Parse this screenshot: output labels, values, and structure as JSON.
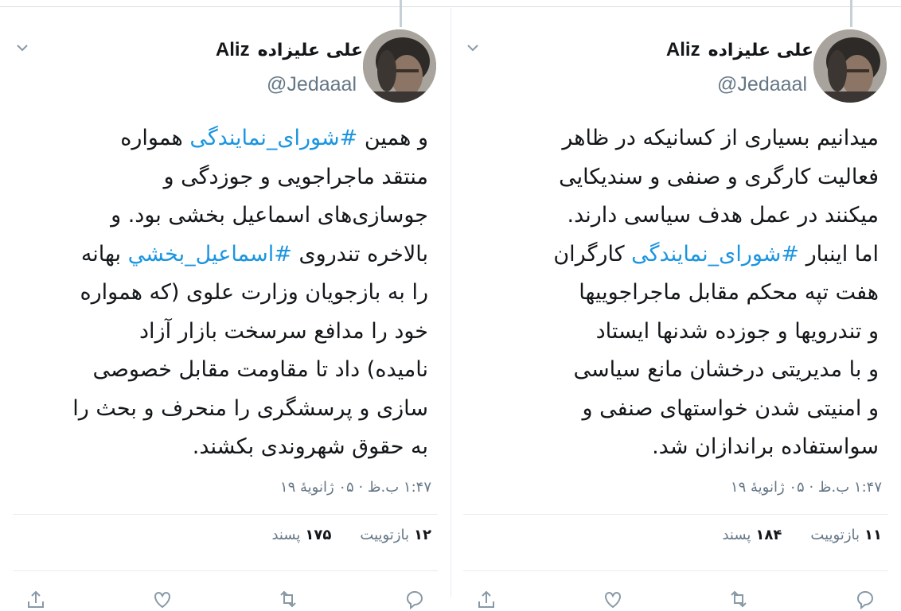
{
  "tweets": [
    {
      "display_name_fa": "علی علیزاده",
      "display_name_latin": "Aliz",
      "handle": "@Jedaaal",
      "body_lines": [
        {
          "pre": "و همین ",
          "tag": "#شورای_نمایندگی",
          "post": " همواره"
        },
        {
          "pre": "منتقد ماجراجویی و جوزدگی و",
          "tag": "",
          "post": ""
        },
        {
          "pre": "جوسازی‌های اسماعیل بخشی بود. و",
          "tag": "",
          "post": ""
        },
        {
          "pre": "بالاخره تندروی ",
          "tag": "#اسماعيل_بخشي",
          "post": " بهانه"
        },
        {
          "pre": "را به بازجویان وزارت علوی (که همواره",
          "tag": "",
          "post": ""
        },
        {
          "pre": "خود را مدافع سرسخت بازار آزاد",
          "tag": "",
          "post": ""
        },
        {
          "pre": "نامیده) داد تا مقاومت مقابل خصوصی",
          "tag": "",
          "post": ""
        },
        {
          "pre": "سازی و پرسشگری را منحرف و بحث را",
          "tag": "",
          "post": ""
        },
        {
          "pre": "به حقوق شهروندی بکشند.",
          "tag": "",
          "post": ""
        }
      ],
      "timestamp": "۱:۴۷ ب.ظ · ۰۵ ژانویهٔ ۱۹",
      "retweets_num": "۱۲",
      "retweets_label": "بازتوییت",
      "likes_num": "۱۷۵",
      "likes_label": "پسند"
    },
    {
      "display_name_fa": "علی علیزاده",
      "display_name_latin": "Aliz",
      "handle": "@Jedaaal",
      "body_lines": [
        {
          "pre": "میدانیم بسیاری از کسانیکه در ظاهر",
          "tag": "",
          "post": ""
        },
        {
          "pre": "فعالیت کارگری و صنفی و سندیکایی",
          "tag": "",
          "post": ""
        },
        {
          "pre": "میکنند در عمل هدف سیاسی دارند.",
          "tag": "",
          "post": ""
        },
        {
          "pre": "اما اینبار ",
          "tag": "#شورای_نمایندگی",
          "post": " کارگران"
        },
        {
          "pre": "هفت تپه محکم مقابل ماجراجوییها",
          "tag": "",
          "post": ""
        },
        {
          "pre": "و تندرویها و جوزده شدنها ایستاد",
          "tag": "",
          "post": ""
        },
        {
          "pre": "و با مدیریتی درخشان مانع سیاسی",
          "tag": "",
          "post": ""
        },
        {
          "pre": "و امنیتی شدن خواستهای صنفی و",
          "tag": "",
          "post": ""
        },
        {
          "pre": "سواستفاده براندازان شد.",
          "tag": "",
          "post": ""
        }
      ],
      "timestamp": "۱:۴۷ ب.ظ · ۰۵ ژانویهٔ ۱۹",
      "retweets_num": "۱۱",
      "retweets_label": "بازتوییت",
      "likes_num": "۱۸۴",
      "likes_label": "پسند"
    }
  ],
  "colors": {
    "hashtag": "#1b95e0",
    "muted": "#657786",
    "text": "#14171a"
  },
  "icons": [
    "chevron-down-icon",
    "reply-icon",
    "retweet-icon",
    "like-icon",
    "share-icon"
  ]
}
